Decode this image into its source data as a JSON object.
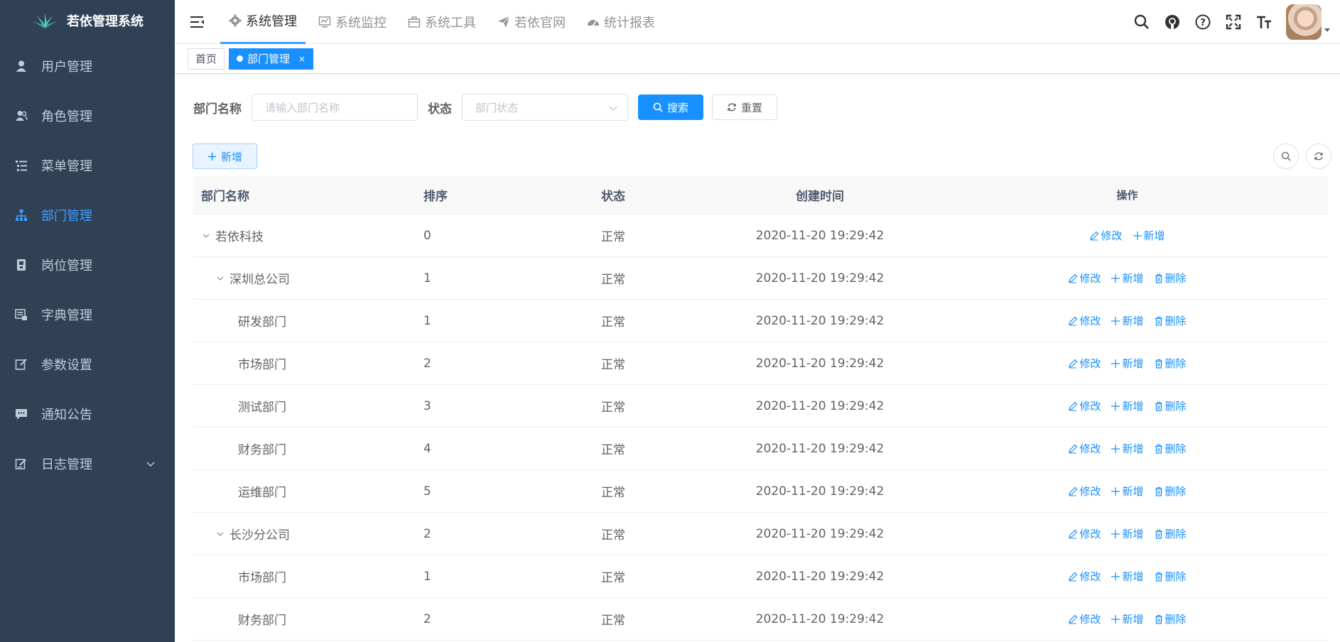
{
  "app": {
    "title": "若依管理系统"
  },
  "sidebar": {
    "items": [
      {
        "label": "用户管理",
        "icon": "user-icon"
      },
      {
        "label": "角色管理",
        "icon": "peoples-icon"
      },
      {
        "label": "菜单管理",
        "icon": "tree-table-icon"
      },
      {
        "label": "部门管理",
        "icon": "tree-icon",
        "active": true
      },
      {
        "label": "岗位管理",
        "icon": "post-icon"
      },
      {
        "label": "字典管理",
        "icon": "dict-icon"
      },
      {
        "label": "参数设置",
        "icon": "edit-icon"
      },
      {
        "label": "通知公告",
        "icon": "message-icon"
      },
      {
        "label": "日志管理",
        "icon": "log-icon",
        "expandable": true
      }
    ]
  },
  "navbar": {
    "tabs": [
      {
        "label": "系统管理",
        "icon": "gear-icon",
        "active": true
      },
      {
        "label": "系统监控",
        "icon": "monitor-icon"
      },
      {
        "label": "系统工具",
        "icon": "toolbox-icon"
      },
      {
        "label": "若依官网",
        "icon": "send-icon"
      },
      {
        "label": "统计报表",
        "icon": "dashboard-icon"
      }
    ],
    "right_icons": [
      "search-icon",
      "github-icon",
      "question-icon",
      "fullscreen-icon",
      "font-size-icon"
    ]
  },
  "tags_view": {
    "home": "首页",
    "active": "部门管理",
    "close": "×"
  },
  "search": {
    "name_label": "部门名称",
    "name_placeholder": "请输入部门名称",
    "status_label": "状态",
    "status_placeholder": "部门状态",
    "search_button": "搜索",
    "reset_button": "重置"
  },
  "toolbar": {
    "add_button": "新增"
  },
  "table": {
    "headers": {
      "name": "部门名称",
      "sort": "排序",
      "status": "状态",
      "time": "创建时间",
      "ops": "操作"
    },
    "ops": {
      "edit": "修改",
      "add": "新增",
      "delete": "删除"
    },
    "rows": [
      {
        "name": "若依科技",
        "sort": "0",
        "status": "正常",
        "time": "2020-11-20 19:29:42",
        "level": 0,
        "expandable": true,
        "deletable": false
      },
      {
        "name": "深圳总公司",
        "sort": "1",
        "status": "正常",
        "time": "2020-11-20 19:29:42",
        "level": 1,
        "expandable": true,
        "deletable": true
      },
      {
        "name": "研发部门",
        "sort": "1",
        "status": "正常",
        "time": "2020-11-20 19:29:42",
        "level": 2,
        "expandable": false,
        "deletable": true
      },
      {
        "name": "市场部门",
        "sort": "2",
        "status": "正常",
        "time": "2020-11-20 19:29:42",
        "level": 2,
        "expandable": false,
        "deletable": true
      },
      {
        "name": "测试部门",
        "sort": "3",
        "status": "正常",
        "time": "2020-11-20 19:29:42",
        "level": 2,
        "expandable": false,
        "deletable": true
      },
      {
        "name": "财务部门",
        "sort": "4",
        "status": "正常",
        "time": "2020-11-20 19:29:42",
        "level": 2,
        "expandable": false,
        "deletable": true
      },
      {
        "name": "运维部门",
        "sort": "5",
        "status": "正常",
        "time": "2020-11-20 19:29:42",
        "level": 2,
        "expandable": false,
        "deletable": true
      },
      {
        "name": "长沙分公司",
        "sort": "2",
        "status": "正常",
        "time": "2020-11-20 19:29:42",
        "level": 1,
        "expandable": true,
        "deletable": true
      },
      {
        "name": "市场部门",
        "sort": "1",
        "status": "正常",
        "time": "2020-11-20 19:29:42",
        "level": 2,
        "expandable": false,
        "deletable": true
      },
      {
        "name": "财务部门",
        "sort": "2",
        "status": "正常",
        "time": "2020-11-20 19:29:42",
        "level": 2,
        "expandable": false,
        "deletable": true
      }
    ]
  },
  "colors": {
    "sidebar_bg": "#304156",
    "primary": "#1890ff",
    "active_menu": "#409eff"
  }
}
